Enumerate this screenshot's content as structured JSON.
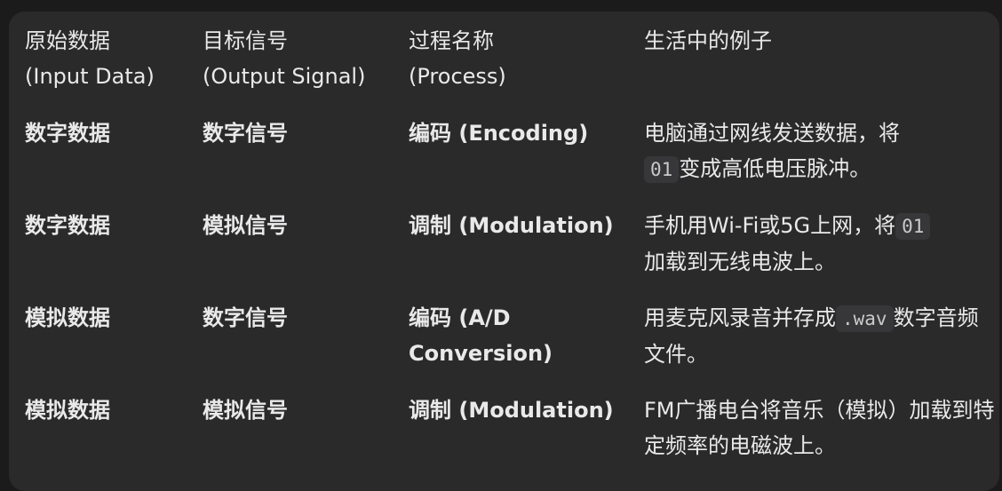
{
  "header": {
    "col1": {
      "zh": "原始数据",
      "en": "(Input Data)"
    },
    "col2": {
      "zh": "目标信号",
      "en": "(Output Signal)"
    },
    "col3": {
      "zh": "过程名称",
      "en": "(Process)"
    },
    "col4": {
      "zh": "生活中的例子"
    }
  },
  "rows": [
    {
      "input": "数字数据",
      "output": "数字信号",
      "process": "编码 (Encoding)",
      "example": {
        "pre": "电脑通过网线发送数据，将",
        "code": "01",
        "post": "变成高低电压脉冲。"
      }
    },
    {
      "input": "数字数据",
      "output": "模拟信号",
      "process": "调制 (Modulation)",
      "example": {
        "pre": "手机用Wi-Fi或5G上网，将",
        "code": "01",
        "post": "加载到无线电波上。"
      }
    },
    {
      "input": "模拟数据",
      "output": "数字信号",
      "process": "编码 (A/D Conversion)",
      "example": {
        "pre": "用麦克风录音并存成",
        "code": ".wav",
        "post": "数字音频文件。"
      }
    },
    {
      "input": "模拟数据",
      "output": "模拟信号",
      "process": "调制 (Modulation)",
      "example": {
        "pre": "FM广播电台将音乐（模拟）加载到特定频率的电磁波上。",
        "code": "",
        "post": ""
      }
    }
  ]
}
